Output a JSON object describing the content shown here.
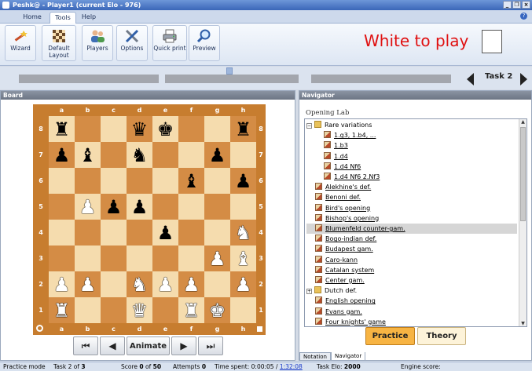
{
  "window": {
    "title": "Peshk@ - Player1 (current Elo - 976)"
  },
  "tabs": [
    {
      "label": "Home",
      "active": false
    },
    {
      "label": "Tools",
      "active": true
    },
    {
      "label": "Help",
      "active": false
    }
  ],
  "ribbon": {
    "buttons": [
      {
        "label": "Wizard",
        "icon": "wizard-icon"
      },
      {
        "label": "Default Layout",
        "icon": "chessboard-icon"
      },
      {
        "label": "Players",
        "icon": "players-icon"
      },
      {
        "label": "Options",
        "icon": "options-icon"
      },
      {
        "label": "Quick print",
        "icon": "printer-icon"
      },
      {
        "label": "Preview",
        "icon": "magnifier-icon"
      }
    ],
    "turn_text": "White to play",
    "turn_color": "#e01010"
  },
  "task": {
    "label": "Task 2"
  },
  "board_panel": {
    "title": "Board",
    "files": [
      "a",
      "b",
      "c",
      "d",
      "e",
      "f",
      "g",
      "h"
    ],
    "ranks": [
      "8",
      "7",
      "6",
      "5",
      "4",
      "3",
      "2",
      "1"
    ],
    "rows": [
      [
        "br",
        "",
        "",
        "bq",
        "bk",
        "",
        "",
        "br"
      ],
      [
        "bp",
        "bb",
        "",
        "bn",
        "",
        "",
        "bp",
        ""
      ],
      [
        "",
        "",
        "",
        "",
        "",
        "bb",
        "",
        "bp"
      ],
      [
        "",
        "wp",
        "bp",
        "bp",
        "",
        "",
        "",
        ""
      ],
      [
        "",
        "",
        "",
        "",
        "bp",
        "",
        "",
        "wn"
      ],
      [
        "",
        "",
        "",
        "",
        "",
        "",
        "wp",
        "wb"
      ],
      [
        "wp",
        "wp",
        "",
        "wn",
        "wp",
        "wp",
        "",
        "wp"
      ],
      [
        "wr",
        "",
        "",
        "wq",
        "",
        "wr",
        "wk",
        ""
      ]
    ],
    "nav_buttons": {
      "first": "⏮",
      "prev": "◀",
      "animate": "Animate",
      "next": "▶",
      "last": "⏭"
    }
  },
  "navigator": {
    "title": "Navigator",
    "heading": "Opening Lab",
    "items": [
      {
        "label": "Rare variations",
        "type": "folder",
        "level": 0,
        "expander": "−",
        "link": false
      },
      {
        "label": "1.g3, 1.b4, ...",
        "type": "leaf",
        "level": 1,
        "link": true
      },
      {
        "label": "1.b3",
        "type": "leaf",
        "level": 1,
        "link": true
      },
      {
        "label": "1.d4",
        "type": "leaf",
        "level": 1,
        "link": true
      },
      {
        "label": "1.d4 Nf6",
        "type": "leaf",
        "level": 1,
        "link": true
      },
      {
        "label": "1.d4 Nf6 2.Nf3",
        "type": "leaf",
        "level": 1,
        "link": true
      },
      {
        "label": "Alekhine's def.",
        "type": "leaf",
        "level": 0,
        "link": true
      },
      {
        "label": "Benoni def.",
        "type": "leaf",
        "level": 0,
        "link": true
      },
      {
        "label": "Bird's opening",
        "type": "leaf",
        "level": 0,
        "link": true
      },
      {
        "label": "Bishop's opening",
        "type": "leaf",
        "level": 0,
        "link": true
      },
      {
        "label": "Blumenfeld counter-gam.",
        "type": "leaf",
        "level": 0,
        "link": true,
        "selected": true
      },
      {
        "label": "Bogo-indian def.",
        "type": "leaf",
        "level": 0,
        "link": true
      },
      {
        "label": "Budapest gam.",
        "type": "leaf",
        "level": 0,
        "link": true
      },
      {
        "label": "Caro-kann",
        "type": "leaf",
        "level": 0,
        "link": true
      },
      {
        "label": "Catalan system",
        "type": "leaf",
        "level": 0,
        "link": true
      },
      {
        "label": "Center gam.",
        "type": "leaf",
        "level": 0,
        "link": true
      },
      {
        "label": "Dutch def.",
        "type": "folder",
        "level": 0,
        "expander": "+",
        "link": false
      },
      {
        "label": "English opening",
        "type": "leaf",
        "level": 0,
        "link": true
      },
      {
        "label": "Evans gam.",
        "type": "leaf",
        "level": 0,
        "link": true
      },
      {
        "label": "Four knights' game",
        "type": "leaf",
        "level": 0,
        "link": true
      }
    ],
    "practice_label": "Practice",
    "theory_label": "Theory",
    "bottom_tabs": [
      {
        "label": "Notation",
        "active": false
      },
      {
        "label": "Navigator",
        "active": true
      }
    ]
  },
  "statusbar": {
    "mode": "Practice mode",
    "task_prefix": "Task 2 of",
    "task_total": "3",
    "score_prefix": "Score",
    "score_value": "0",
    "score_of": "of",
    "score_max": "50",
    "attempts_label": "Attempts",
    "attempts_value": "0",
    "time_label": "Time spent:",
    "time_value": "0:00:05",
    "time_sep": "/",
    "time_total": "1:32:08",
    "task_elo_label": "Task Elo:",
    "task_elo_value": "2000",
    "engine_label": "Engine score:"
  }
}
